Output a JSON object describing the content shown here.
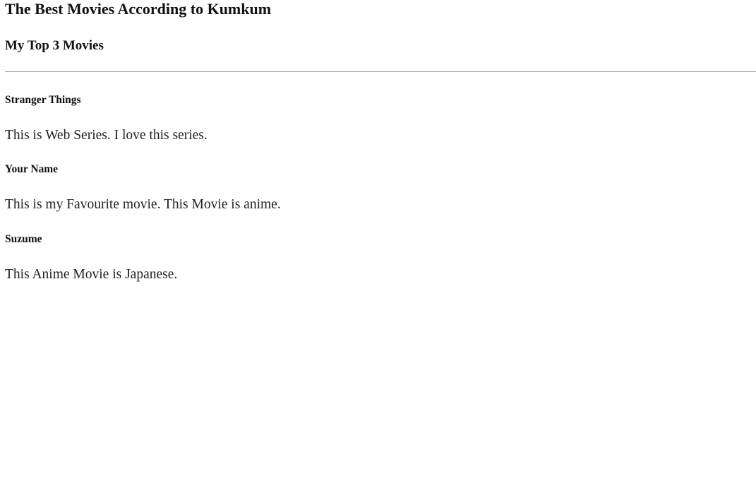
{
  "page": {
    "title": "The Best Movies According to Kumkum",
    "subtitle": "My Top 3 Movies"
  },
  "movies": [
    {
      "title": "Stranger Things",
      "description": "This is Web Series. I love this series."
    },
    {
      "title": "Your Name",
      "description": "This is my Favourite movie. This Movie is anime."
    },
    {
      "title": "Suzume",
      "description": "This Anime Movie is Japanese."
    }
  ]
}
